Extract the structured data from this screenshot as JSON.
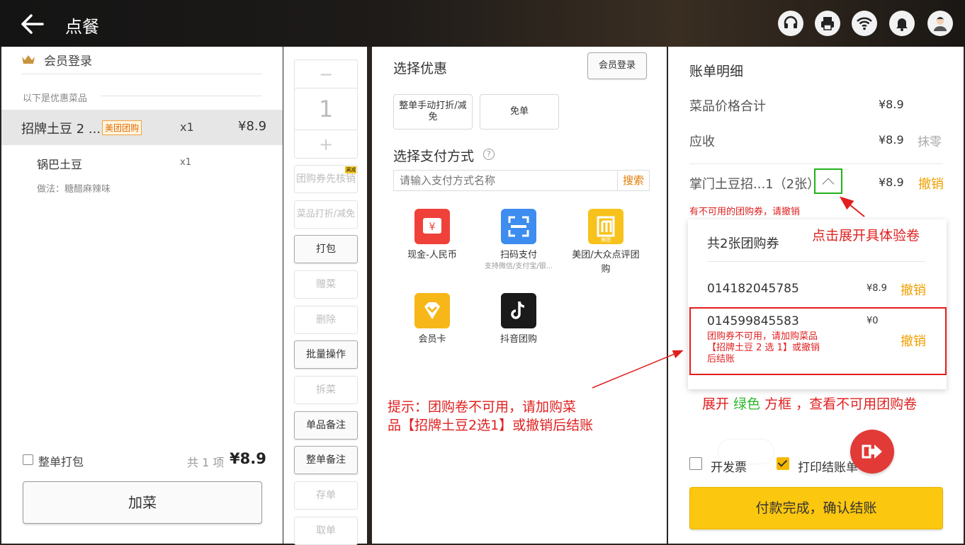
{
  "header": {
    "title": "点餐"
  },
  "left": {
    "member_login": "会员登录",
    "promo_label": "以下是优惠菜品",
    "items": [
      {
        "name": "招牌土豆 2 ...",
        "tag": "美团团购",
        "qty": "x1",
        "price": "¥8.9"
      },
      {
        "name": "锅巴土豆",
        "qty": "x1",
        "method": "做法：糖醋麻辣味"
      }
    ],
    "pack_all": "整单打包",
    "total_count": "共 1 项",
    "total_amount": "¥8.9",
    "add_button": "加菜"
  },
  "ops": {
    "minus": "−",
    "value": "1",
    "plus": "+",
    "buttons": [
      "团购券先核销",
      "菜品打折/减免",
      "打包",
      "赠菜",
      "删除",
      "批量操作",
      "拆菜",
      "单品备注",
      "整单备注",
      "存单",
      "取单"
    ],
    "badge": "满减"
  },
  "payment": {
    "title": "选择优惠",
    "member_login": "会员登录",
    "discount_manual": "整单手动打折/减免",
    "discount_free": "免单",
    "method_title": "选择支付方式",
    "help": "?",
    "search_placeholder": "请输入支付方式名称",
    "search_button": "搜索",
    "methods": [
      {
        "label": "现金-人民币",
        "icon": "yen-icon",
        "color": "#f0403a"
      },
      {
        "label": "扫码支付",
        "sub": "支持微信/支付宝/银...",
        "icon": "scan-icon",
        "color": "#3d8cf0"
      },
      {
        "label": "美团/大众点评团购",
        "icon": "meituan-icon",
        "color": "#f7c21c",
        "icon_text": "美团"
      },
      {
        "label": "会员卡",
        "icon": "vip-card-icon",
        "color": "#f7b718"
      },
      {
        "label": "抖音团购",
        "icon": "douyin-icon",
        "color": "#1a1a1a"
      }
    ],
    "hint_line1": "提示：团购卷不可用，请加购菜",
    "hint_line2": "品【招牌土豆2选1】或撤销后结账"
  },
  "bill": {
    "title": "账单明细",
    "subtotal_label": "菜品价格合计",
    "subtotal_value": "¥8.9",
    "receivable_label": "应收",
    "receivable_value": "¥8.9",
    "round_off": "抹零",
    "coupon_label": "掌门土豆招...1（2张）",
    "coupon_value": "¥8.9",
    "coupon_revoke": "撤销",
    "coupon_warning": "有不可用的团购券，请撤销",
    "popup": {
      "title": "共2张团购券",
      "coupons": [
        {
          "code": "014182045785",
          "value": "¥8.9",
          "revoke": "撤销"
        },
        {
          "code": "014599845583",
          "value": "¥0",
          "revoke": "撤销",
          "message": "团购券不可用，请加购菜品【招牌土豆 2 选 1】或撤销后结账"
        }
      ]
    },
    "click_note": "点击展开具体验卷",
    "expand_note_prefix": "展开 ",
    "expand_note_green": "绿色",
    "expand_note_suffix": " 方框 ，查看不可用团购卷",
    "invoice_label": "开发票",
    "print_label": "打印结账单",
    "confirm_button": "付款完成，确认结账"
  },
  "colors": {
    "accent": "#fcc70f",
    "warning": "#e02020",
    "revoke": "#f0a000",
    "green_box": "#21b21d"
  }
}
